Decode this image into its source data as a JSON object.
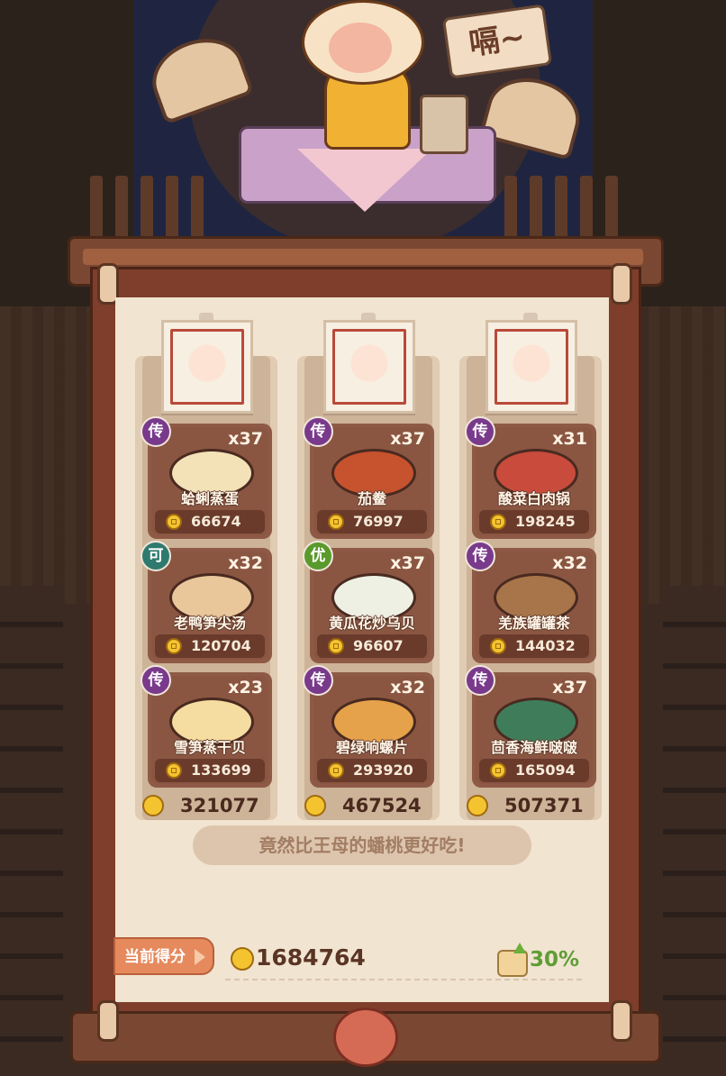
{
  "header": {
    "sign_text": "嗝~"
  },
  "columns": [
    {
      "dishes": [
        {
          "badge": "传",
          "badge_type": "chuan",
          "qty": "x37",
          "name": "蛤蜊蒸蛋",
          "price": "66674",
          "dish_color": "#f3e2b8"
        },
        {
          "badge": "可",
          "badge_type": "ke",
          "qty": "x32",
          "name": "老鸭笋尖汤",
          "price": "120704",
          "dish_color": "#e9c79a"
        },
        {
          "badge": "传",
          "badge_type": "chuan",
          "qty": "x23",
          "name": "雪笋蒸干贝",
          "price": "133699",
          "dish_color": "#f5dca0"
        }
      ],
      "total": "321077"
    },
    {
      "dishes": [
        {
          "badge": "传",
          "badge_type": "chuan",
          "qty": "x37",
          "name": "茄鲞",
          "price": "76997",
          "dish_color": "#c6522e"
        },
        {
          "badge": "优",
          "badge_type": "you",
          "qty": "x37",
          "name": "黄瓜花炒乌贝",
          "price": "96607",
          "dish_color": "#eef0e4"
        },
        {
          "badge": "传",
          "badge_type": "chuan",
          "qty": "x32",
          "name": "碧绿响螺片",
          "price": "293920",
          "dish_color": "#e5a24a"
        }
      ],
      "total": "467524"
    },
    {
      "dishes": [
        {
          "badge": "传",
          "badge_type": "chuan",
          "qty": "x31",
          "name": "酸菜白肉锅",
          "price": "198245",
          "dish_color": "#c84b3c"
        },
        {
          "badge": "传",
          "badge_type": "chuan",
          "qty": "x32",
          "name": "羌族罐罐茶",
          "price": "144032",
          "dish_color": "#a8744a"
        },
        {
          "badge": "传",
          "badge_type": "chuan",
          "qty": "x37",
          "name": "茴香海鲜啵啵",
          "price": "165094",
          "dish_color": "#3f7d5a"
        }
      ],
      "total": "507371"
    }
  ],
  "quote": "竟然比王母的蟠桃更好吃!",
  "score": {
    "label": "当前得分",
    "value": "1684764",
    "bonus": "30%"
  },
  "colors": {
    "scroll_frame": "#7e3e2b",
    "paper": "#f1e4d0",
    "card": "#8a5642",
    "legendary_badge": "#7a3a8c",
    "bonus_green": "#5e9d35"
  }
}
